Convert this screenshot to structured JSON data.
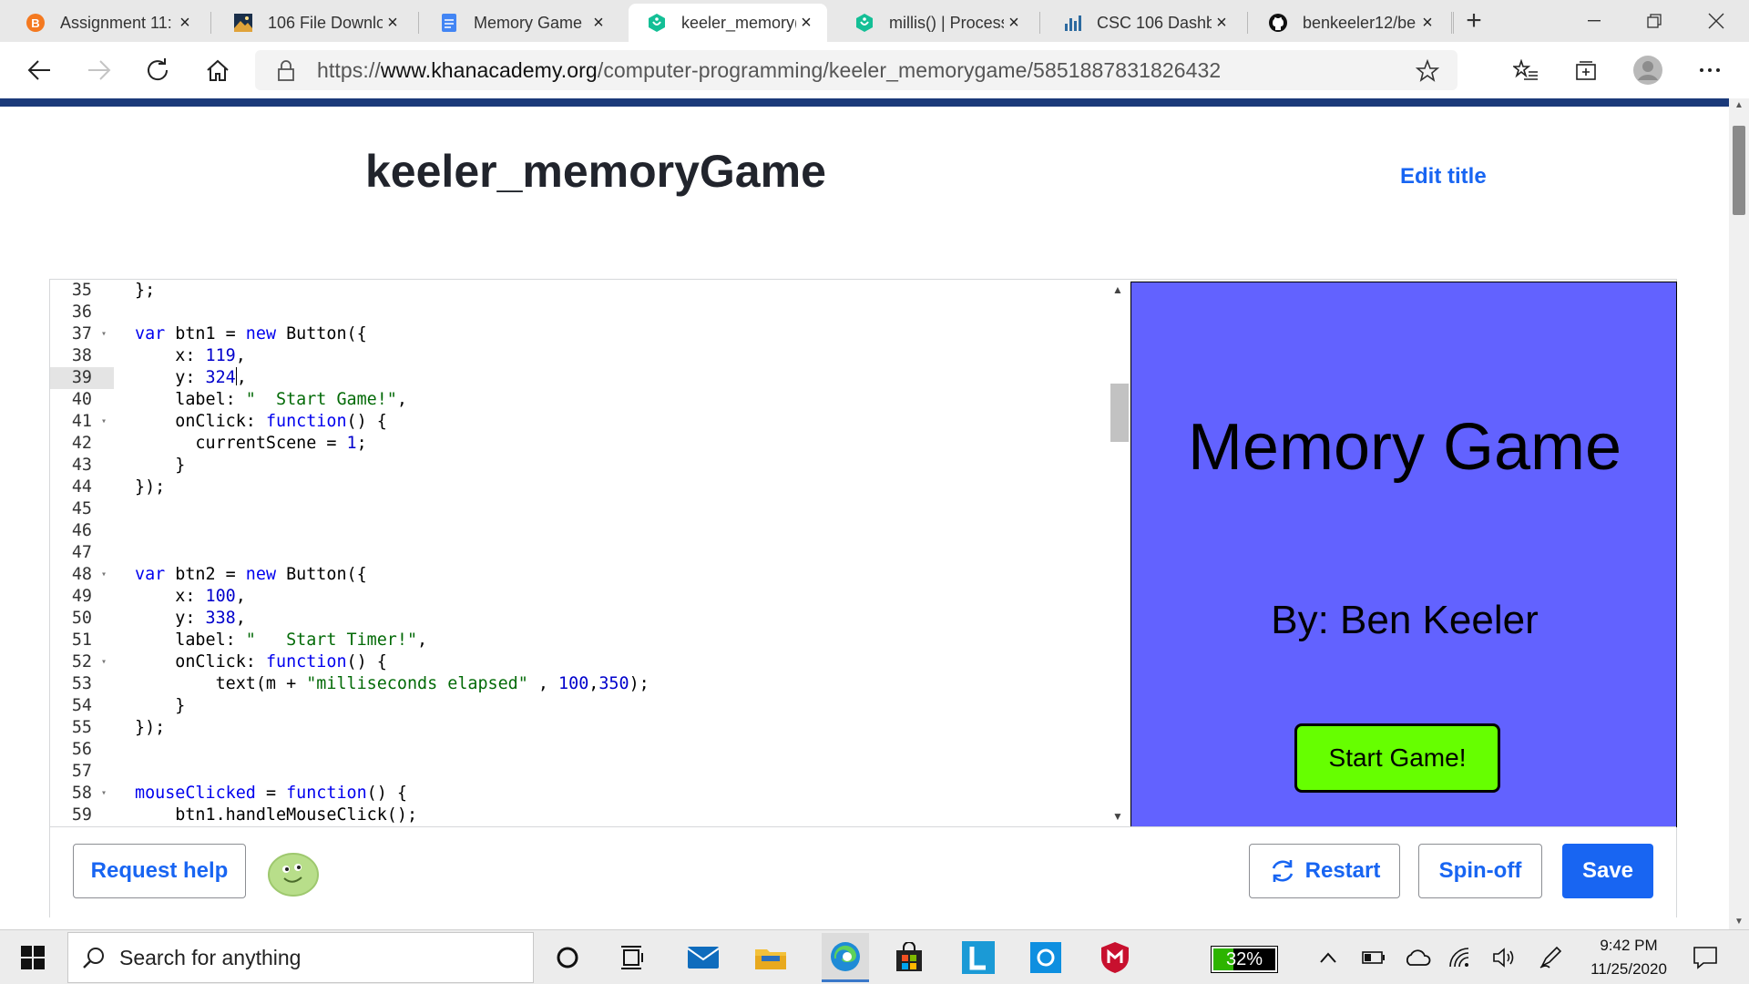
{
  "browser": {
    "tabs": [
      {
        "label": "Assignment 11:",
        "icon": "b-circle-icon",
        "color": "#f47920"
      },
      {
        "label": "106 File Downlo",
        "icon": "landscape-icon",
        "color": "#2c6aa0"
      },
      {
        "label": "Memory Game",
        "icon": "docs-icon",
        "color": "#4285f4"
      },
      {
        "label": "keeler_memory(",
        "icon": "khan-academy-icon",
        "color": "#14bf96",
        "active": true
      },
      {
        "label": "millis() | Process",
        "icon": "khan-academy-icon",
        "color": "#14bf96"
      },
      {
        "label": "CSC 106 Dashbo",
        "icon": "bar-chart-icon",
        "color": "#2c6aa0"
      },
      {
        "label": "benkeeler12/be",
        "icon": "github-icon",
        "color": "#111111"
      }
    ],
    "close_glyph": "×",
    "new_tab_glyph": "+",
    "url_scheme": "https://",
    "url_host": "www.khanacademy.org",
    "url_path": "/computer-programming/keeler_memorygame/5851887831826432"
  },
  "page": {
    "title": "keeler_memoryGame",
    "edit_title": "Edit title"
  },
  "editor": {
    "current_line": 39,
    "lines": [
      {
        "n": "35",
        "fold": false,
        "tokens": [
          [
            "p",
            "};"
          ]
        ]
      },
      {
        "n": "36",
        "fold": false,
        "tokens": []
      },
      {
        "n": "37",
        "fold": true,
        "tokens": [
          [
            "kw",
            "var"
          ],
          [
            "p",
            " btn1 = "
          ],
          [
            "kw",
            "new"
          ],
          [
            "p",
            " Button({"
          ]
        ]
      },
      {
        "n": "38",
        "fold": false,
        "tokens": [
          [
            "p",
            "    x: "
          ],
          [
            "num",
            "119"
          ],
          [
            "p",
            ","
          ]
        ]
      },
      {
        "n": "39",
        "fold": false,
        "tokens": [
          [
            "p",
            "    y: "
          ],
          [
            "num",
            "324"
          ],
          [
            "caret",
            ""
          ],
          [
            "p",
            ","
          ]
        ]
      },
      {
        "n": "40",
        "fold": false,
        "tokens": [
          [
            "p",
            "    label: "
          ],
          [
            "str",
            "\"  Start Game!\""
          ],
          [
            "p",
            ","
          ]
        ]
      },
      {
        "n": "41",
        "fold": true,
        "tokens": [
          [
            "p",
            "    onClick: "
          ],
          [
            "kw",
            "function"
          ],
          [
            "p",
            "() {"
          ]
        ]
      },
      {
        "n": "42",
        "fold": false,
        "tokens": [
          [
            "p",
            "      currentScene = "
          ],
          [
            "num",
            "1"
          ],
          [
            "p",
            ";"
          ]
        ]
      },
      {
        "n": "43",
        "fold": false,
        "tokens": [
          [
            "p",
            "    }"
          ]
        ]
      },
      {
        "n": "44",
        "fold": false,
        "tokens": [
          [
            "p",
            "});"
          ]
        ]
      },
      {
        "n": "45",
        "fold": false,
        "tokens": []
      },
      {
        "n": "46",
        "fold": false,
        "tokens": []
      },
      {
        "n": "47",
        "fold": false,
        "tokens": []
      },
      {
        "n": "48",
        "fold": true,
        "tokens": [
          [
            "kw",
            "var"
          ],
          [
            "p",
            " btn2 = "
          ],
          [
            "kw",
            "new"
          ],
          [
            "p",
            " Button({"
          ]
        ]
      },
      {
        "n": "49",
        "fold": false,
        "tokens": [
          [
            "p",
            "    x: "
          ],
          [
            "num",
            "100"
          ],
          [
            "p",
            ","
          ]
        ]
      },
      {
        "n": "50",
        "fold": false,
        "tokens": [
          [
            "p",
            "    y: "
          ],
          [
            "num",
            "338"
          ],
          [
            "p",
            ","
          ]
        ]
      },
      {
        "n": "51",
        "fold": false,
        "tokens": [
          [
            "p",
            "    label: "
          ],
          [
            "str",
            "\"   Start Timer!\""
          ],
          [
            "p",
            ","
          ]
        ]
      },
      {
        "n": "52",
        "fold": true,
        "tokens": [
          [
            "p",
            "    onClick: "
          ],
          [
            "kw",
            "function"
          ],
          [
            "p",
            "() {"
          ]
        ]
      },
      {
        "n": "53",
        "fold": false,
        "tokens": [
          [
            "p",
            "        text(m + "
          ],
          [
            "str",
            "\"milliseconds elapsed\""
          ],
          [
            "p",
            " , "
          ],
          [
            "num",
            "100"
          ],
          [
            "p",
            ","
          ],
          [
            "num",
            "350"
          ],
          [
            "p",
            ");"
          ]
        ]
      },
      {
        "n": "54",
        "fold": false,
        "tokens": [
          [
            "p",
            "    }"
          ]
        ]
      },
      {
        "n": "55",
        "fold": false,
        "tokens": [
          [
            "p",
            "});"
          ]
        ]
      },
      {
        "n": "56",
        "fold": false,
        "tokens": []
      },
      {
        "n": "57",
        "fold": false,
        "tokens": []
      },
      {
        "n": "58",
        "fold": true,
        "tokens": [
          [
            "kw",
            "mouseClicked"
          ],
          [
            "p",
            " = "
          ],
          [
            "kw",
            "function"
          ],
          [
            "p",
            "() {"
          ]
        ]
      },
      {
        "n": "59",
        "fold": false,
        "tokens": [
          [
            "p",
            "    btn1.handleMouseClick();"
          ]
        ]
      }
    ]
  },
  "canvas": {
    "title": "Memory Game",
    "byline": "By: Ben Keeler",
    "button_label": "Start Game!",
    "background": "#6262ff",
    "button_color": "#66ff00"
  },
  "toolbar": {
    "request_help": "Request help",
    "restart": "Restart",
    "spinoff": "Spin-off",
    "save": "Save"
  },
  "taskbar": {
    "search_text": "Search for anything",
    "battery_percent": "32%",
    "battery_level": 0.32,
    "time": "9:42 PM",
    "date": "11/25/2020"
  },
  "colors": {
    "accent_blue": "#1865f2",
    "header_bar": "#1b3a7a"
  }
}
